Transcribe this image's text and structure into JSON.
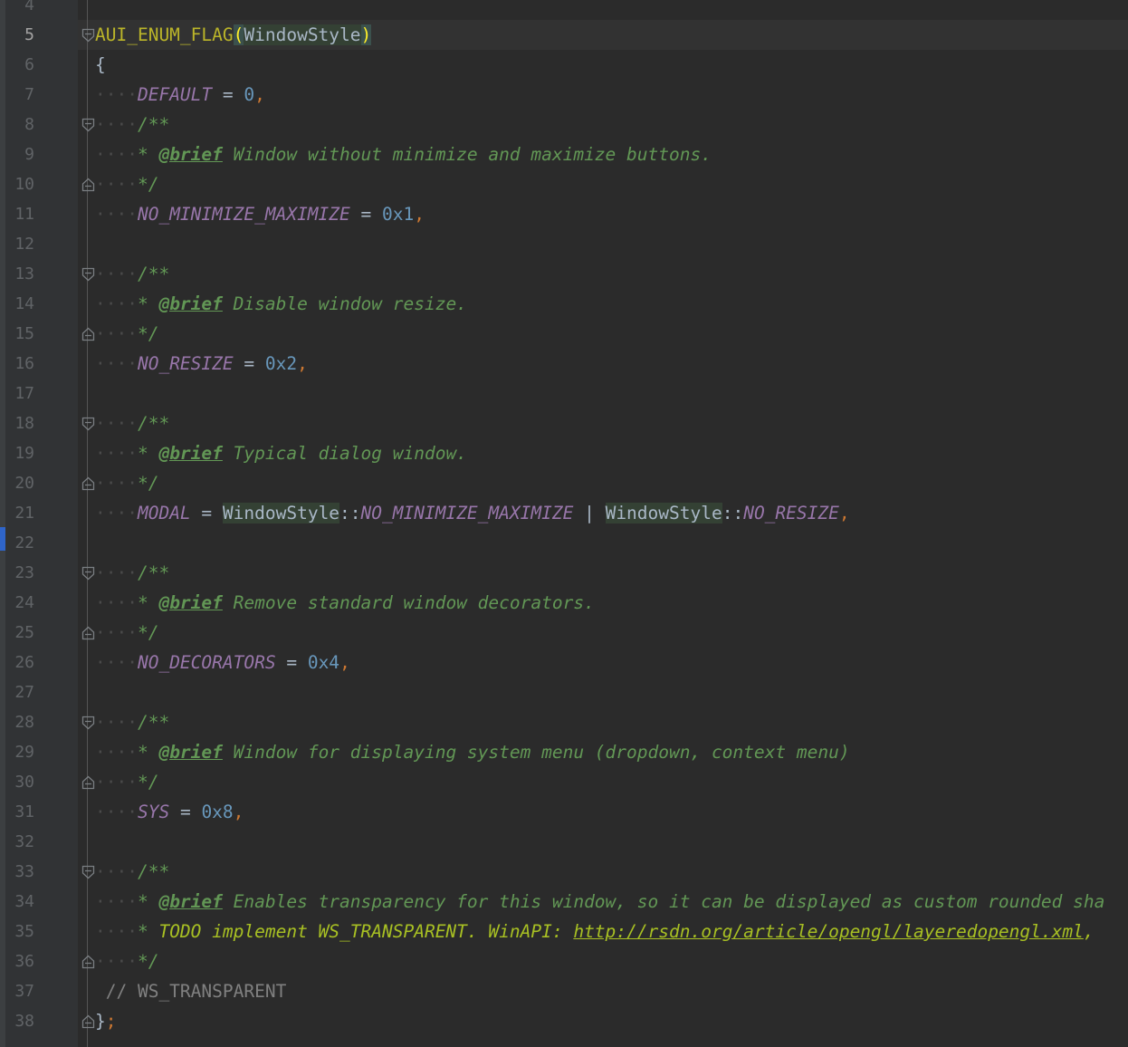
{
  "editor": {
    "current_line": "5",
    "lines": [
      {
        "num": "4",
        "tokens": []
      },
      {
        "num": "5",
        "tokens": [
          {
            "c": "c-macro",
            "t": "AUI_ENUM_FLAG"
          },
          {
            "c": "c-paren-hl",
            "t": "("
          },
          {
            "c": "c-ident-hl",
            "t": "WindowStyle"
          },
          {
            "c": "c-paren-hl",
            "t": ")"
          }
        ]
      },
      {
        "num": "6",
        "tokens": [
          {
            "c": "c-op",
            "t": "{"
          }
        ]
      },
      {
        "num": "7",
        "tokens": [
          {
            "c": "c-ws",
            "t": "····"
          },
          {
            "c": "c-enum",
            "t": "DEFAULT"
          },
          {
            "c": "c-op",
            "t": " = "
          },
          {
            "c": "c-num",
            "t": "0"
          },
          {
            "c": "c-comma",
            "t": ","
          }
        ]
      },
      {
        "num": "8",
        "tokens": [
          {
            "c": "c-ws",
            "t": "····"
          },
          {
            "c": "c-doc",
            "t": "/**"
          }
        ]
      },
      {
        "num": "9",
        "tokens": [
          {
            "c": "c-ws",
            "t": "····"
          },
          {
            "c": "c-doc",
            "t": "* "
          },
          {
            "c": "c-tag",
            "t": "@brief"
          },
          {
            "c": "c-doc",
            "t": " Window without minimize and maximize buttons."
          }
        ]
      },
      {
        "num": "10",
        "tokens": [
          {
            "c": "c-ws",
            "t": "····"
          },
          {
            "c": "c-doc",
            "t": "*/"
          }
        ]
      },
      {
        "num": "11",
        "tokens": [
          {
            "c": "c-ws",
            "t": "····"
          },
          {
            "c": "c-enum",
            "t": "NO_MINIMIZE_MAXIMIZE"
          },
          {
            "c": "c-op",
            "t": " = "
          },
          {
            "c": "c-num",
            "t": "0x1"
          },
          {
            "c": "c-comma",
            "t": ","
          }
        ]
      },
      {
        "num": "12",
        "tokens": []
      },
      {
        "num": "13",
        "tokens": [
          {
            "c": "c-ws",
            "t": "····"
          },
          {
            "c": "c-doc",
            "t": "/**"
          }
        ]
      },
      {
        "num": "14",
        "tokens": [
          {
            "c": "c-ws",
            "t": "····"
          },
          {
            "c": "c-doc",
            "t": "* "
          },
          {
            "c": "c-tag",
            "t": "@brief"
          },
          {
            "c": "c-doc",
            "t": " Disable window resize."
          }
        ]
      },
      {
        "num": "15",
        "tokens": [
          {
            "c": "c-ws",
            "t": "····"
          },
          {
            "c": "c-doc",
            "t": "*/"
          }
        ]
      },
      {
        "num": "16",
        "tokens": [
          {
            "c": "c-ws",
            "t": "····"
          },
          {
            "c": "c-enum",
            "t": "NO_RESIZE"
          },
          {
            "c": "c-op",
            "t": " = "
          },
          {
            "c": "c-num",
            "t": "0x2"
          },
          {
            "c": "c-comma",
            "t": ","
          }
        ]
      },
      {
        "num": "17",
        "tokens": []
      },
      {
        "num": "18",
        "tokens": [
          {
            "c": "c-ws",
            "t": "····"
          },
          {
            "c": "c-doc",
            "t": "/**"
          }
        ]
      },
      {
        "num": "19",
        "tokens": [
          {
            "c": "c-ws",
            "t": "····"
          },
          {
            "c": "c-doc",
            "t": "* "
          },
          {
            "c": "c-tag",
            "t": "@brief"
          },
          {
            "c": "c-doc",
            "t": " Typical dialog window."
          }
        ]
      },
      {
        "num": "20",
        "tokens": [
          {
            "c": "c-ws",
            "t": "····"
          },
          {
            "c": "c-doc",
            "t": "*/"
          }
        ]
      },
      {
        "num": "21",
        "tokens": [
          {
            "c": "c-ws",
            "t": "····"
          },
          {
            "c": "c-enum",
            "t": "MODAL"
          },
          {
            "c": "c-op",
            "t": " = "
          },
          {
            "c": "c-ident-hl",
            "t": "WindowStyle"
          },
          {
            "c": "c-scope",
            "t": "::"
          },
          {
            "c": "c-enum",
            "t": "NO_MINIMIZE_MAXIMIZE"
          },
          {
            "c": "c-op",
            "t": " | "
          },
          {
            "c": "c-ident-hl",
            "t": "WindowStyle"
          },
          {
            "c": "c-scope",
            "t": "::"
          },
          {
            "c": "c-enum",
            "t": "NO_RESIZE"
          },
          {
            "c": "c-comma",
            "t": ","
          }
        ]
      },
      {
        "num": "22",
        "tokens": []
      },
      {
        "num": "23",
        "tokens": [
          {
            "c": "c-ws",
            "t": "····"
          },
          {
            "c": "c-doc",
            "t": "/**"
          }
        ]
      },
      {
        "num": "24",
        "tokens": [
          {
            "c": "c-ws",
            "t": "····"
          },
          {
            "c": "c-doc",
            "t": "* "
          },
          {
            "c": "c-tag",
            "t": "@brief"
          },
          {
            "c": "c-doc",
            "t": " Remove standard window decorators."
          }
        ]
      },
      {
        "num": "25",
        "tokens": [
          {
            "c": "c-ws",
            "t": "····"
          },
          {
            "c": "c-doc",
            "t": "*/"
          }
        ]
      },
      {
        "num": "26",
        "tokens": [
          {
            "c": "c-ws",
            "t": "····"
          },
          {
            "c": "c-enum",
            "t": "NO_DECORATORS"
          },
          {
            "c": "c-op",
            "t": " = "
          },
          {
            "c": "c-num",
            "t": "0x4"
          },
          {
            "c": "c-comma",
            "t": ","
          }
        ]
      },
      {
        "num": "27",
        "tokens": []
      },
      {
        "num": "28",
        "tokens": [
          {
            "c": "c-ws",
            "t": "····"
          },
          {
            "c": "c-doc",
            "t": "/**"
          }
        ]
      },
      {
        "num": "29",
        "tokens": [
          {
            "c": "c-ws",
            "t": "····"
          },
          {
            "c": "c-doc",
            "t": "* "
          },
          {
            "c": "c-tag",
            "t": "@brief"
          },
          {
            "c": "c-doc",
            "t": " Window for displaying system menu (dropdown, context menu)"
          }
        ]
      },
      {
        "num": "30",
        "tokens": [
          {
            "c": "c-ws",
            "t": "····"
          },
          {
            "c": "c-doc",
            "t": "*/"
          }
        ]
      },
      {
        "num": "31",
        "tokens": [
          {
            "c": "c-ws",
            "t": "····"
          },
          {
            "c": "c-enum",
            "t": "SYS"
          },
          {
            "c": "c-op",
            "t": " = "
          },
          {
            "c": "c-num",
            "t": "0x8"
          },
          {
            "c": "c-comma",
            "t": ","
          }
        ]
      },
      {
        "num": "32",
        "tokens": []
      },
      {
        "num": "33",
        "tokens": [
          {
            "c": "c-ws",
            "t": "····"
          },
          {
            "c": "c-doc",
            "t": "/**"
          }
        ]
      },
      {
        "num": "34",
        "tokens": [
          {
            "c": "c-ws",
            "t": "····"
          },
          {
            "c": "c-doc",
            "t": "* "
          },
          {
            "c": "c-tag",
            "t": "@brief"
          },
          {
            "c": "c-doc",
            "t": " Enables transparency for this window, so it can be displayed as custom rounded sha"
          }
        ]
      },
      {
        "num": "35",
        "tokens": [
          {
            "c": "c-ws",
            "t": "····"
          },
          {
            "c": "c-doc",
            "t": "* "
          },
          {
            "c": "c-todo",
            "t": "TODO implement WS_TRANSPARENT. WinAPI: "
          },
          {
            "c": "c-link",
            "t": "http://rsdn.org/article/opengl/layeredopengl.xml"
          },
          {
            "c": "c-todo",
            "t": ", "
          }
        ]
      },
      {
        "num": "36",
        "tokens": [
          {
            "c": "c-ws",
            "t": "····"
          },
          {
            "c": "c-doc",
            "t": "*/"
          }
        ]
      },
      {
        "num": "37",
        "tokens": [
          {
            "c": "c-comment",
            "t": " // WS_TRANSPARENT"
          }
        ]
      },
      {
        "num": "38",
        "tokens": [
          {
            "c": "c-op",
            "t": "}"
          },
          {
            "c": "c-comma",
            "t": ";"
          }
        ]
      },
      {
        "num": "",
        "tokens": []
      }
    ],
    "folds": {
      "5": "fold-open-icon",
      "8": "fold-open-icon",
      "10": "fold-close-icon",
      "13": "fold-open-icon",
      "15": "fold-close-icon",
      "18": "fold-open-icon",
      "20": "fold-close-icon",
      "23": "fold-open-icon",
      "25": "fold-close-icon",
      "28": "fold-open-icon",
      "30": "fold-close-icon",
      "33": "fold-open-icon",
      "36": "fold-close-icon",
      "38": "fold-close-icon"
    }
  }
}
